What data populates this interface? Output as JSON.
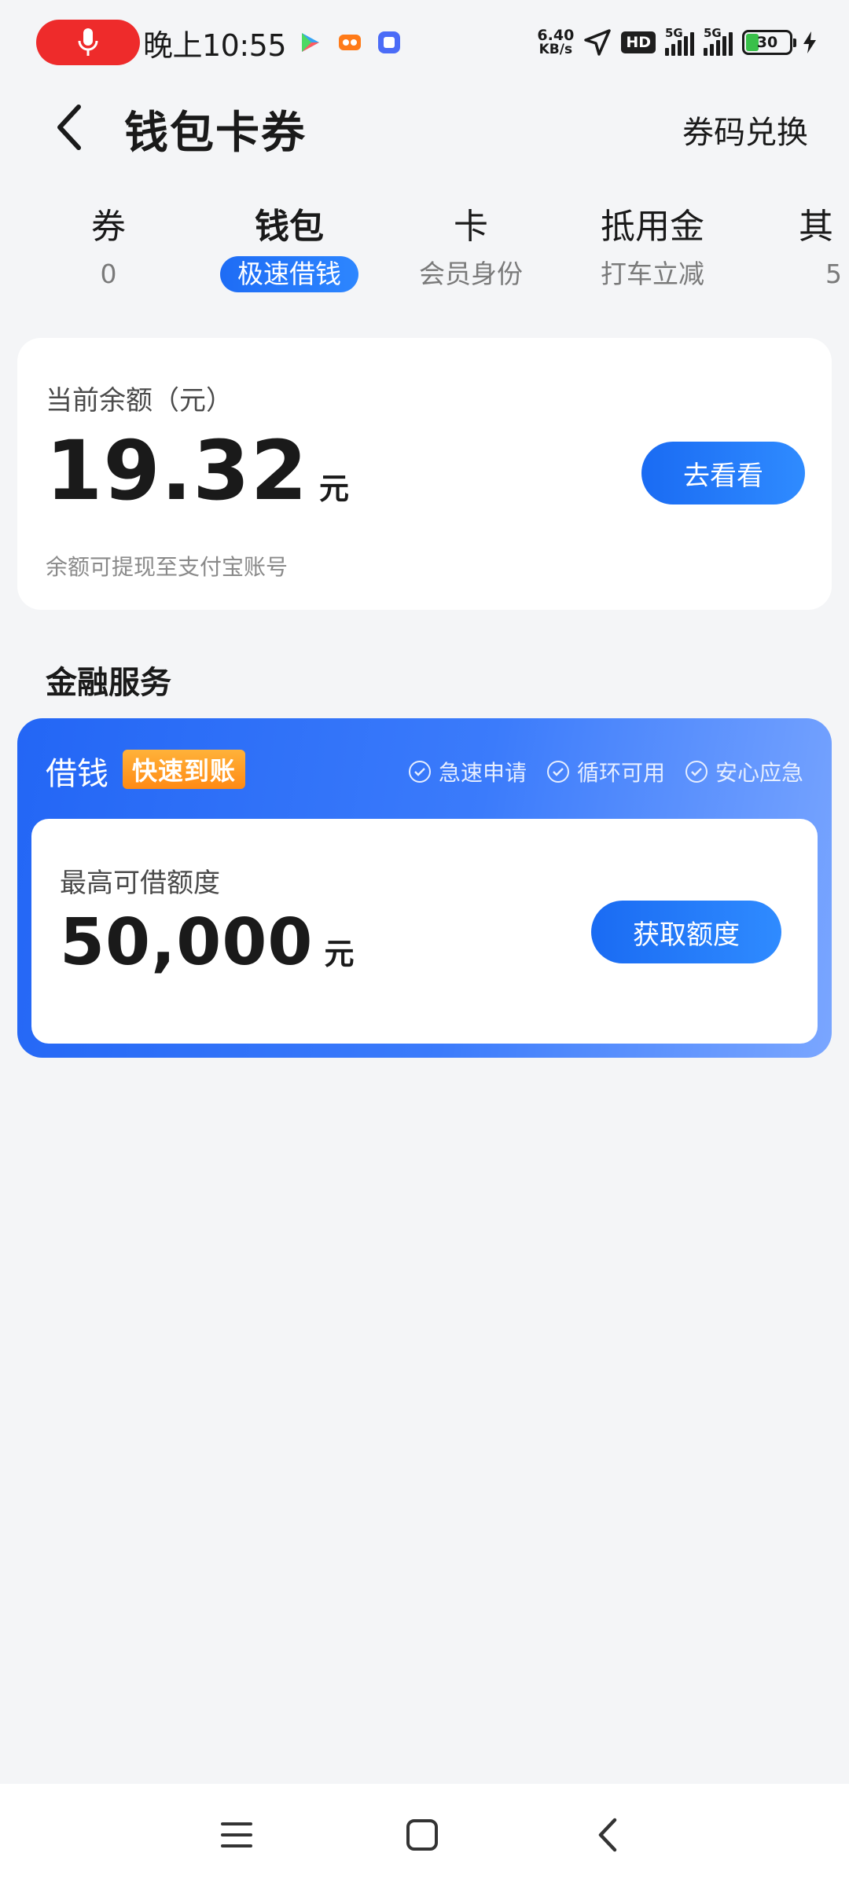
{
  "status_bar": {
    "time": "晚上10:55",
    "net_speed_value": "6.40",
    "net_speed_unit": "KB/s",
    "hd_label": "HD",
    "signal_1_label": "5G",
    "signal_2_label": "5G",
    "battery_percent": "30",
    "battery_level": 0.3,
    "icons": [
      "microphone-icon",
      "play-store-icon",
      "video-app-icon",
      "tieba-app-icon",
      "location-arrow-icon",
      "charging-bolt-icon"
    ]
  },
  "header": {
    "title": "钱包卡券",
    "redeem_label": "券码兑换"
  },
  "tabs": [
    {
      "label": "券",
      "sub": "0",
      "active": false
    },
    {
      "label": "钱包",
      "sub": "极速借钱",
      "active": true
    },
    {
      "label": "卡",
      "sub": "会员身份",
      "active": false
    },
    {
      "label": "抵用金",
      "sub": "打车立减",
      "active": false
    },
    {
      "label": "其",
      "sub": "5",
      "active": false
    }
  ],
  "balance": {
    "label": "当前余额（元）",
    "amount": "19.32",
    "unit": "元",
    "button_label": "去看看",
    "note": "余额可提现至支付宝账号"
  },
  "finance": {
    "section_title": "金融服务",
    "loan_name": "借钱",
    "badge": "快速到账",
    "features": [
      "急速申请",
      "循环可用",
      "安心应急"
    ],
    "limit_label": "最高可借额度",
    "limit_amount": "50,000",
    "limit_unit": "元",
    "button_label": "获取额度"
  },
  "colors": {
    "accent_blue": "#1e6cf5",
    "badge_orange": "#ff8a14",
    "recording_red": "#ee2b2b",
    "battery_green": "#39c04a"
  }
}
